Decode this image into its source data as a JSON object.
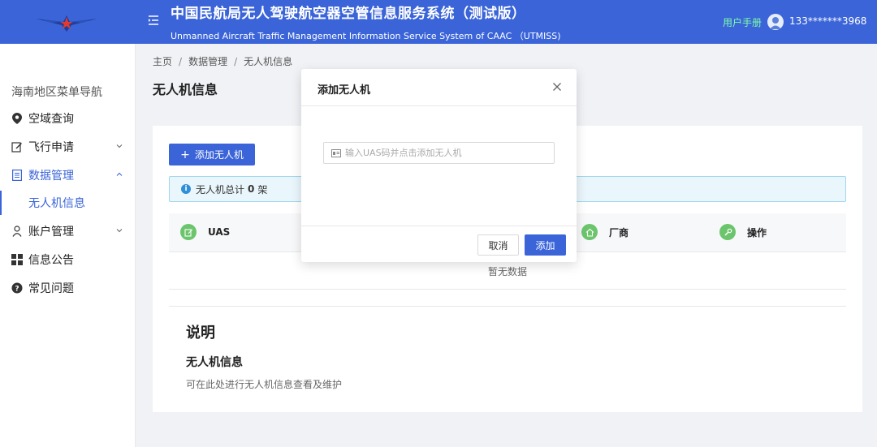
{
  "header": {
    "title_cn": "中国民航局无人驾驶航空器空管信息服务系统（测试版）",
    "title_en": "Unmanned Aircraft Traffic Management Information Service System of CAAC （UTMISS)",
    "manual_link": "用户手册",
    "phone": "133*******3968",
    "brand_color": "#3a64d8",
    "manual_color": "#7fffa8"
  },
  "sidebar": {
    "region_title": "海南地区菜单导航",
    "items": [
      {
        "label": "空域查询",
        "icon": "location-pin-icon"
      },
      {
        "label": "飞行申请",
        "icon": "edit-icon",
        "has_children": true
      },
      {
        "label": "数据管理",
        "icon": "list-icon",
        "has_children": true,
        "expanded": true
      },
      {
        "label": "账户管理",
        "icon": "user-icon",
        "has_children": true
      },
      {
        "label": "信息公告",
        "icon": "grid-icon"
      },
      {
        "label": "常见问题",
        "icon": "question-icon"
      }
    ],
    "sub_items": [
      {
        "label": "无人机信息",
        "active": true
      }
    ]
  },
  "breadcrumb": [
    "主页",
    "数据管理",
    "无人机信息"
  ],
  "page_title": "无人机信息",
  "main": {
    "add_button": "添加无人机",
    "info_prefix": "无人机总计",
    "info_count": "0",
    "info_suffix": "架",
    "table_columns": [
      {
        "label": "UAS",
        "icon": "edit-icon"
      },
      {
        "label": "厂商",
        "icon": "home-icon"
      },
      {
        "label": "操作",
        "icon": "wrench-icon"
      }
    ],
    "empty_text": "暂无数据",
    "section_title": "说明",
    "section_subtitle": "无人机信息",
    "section_desc": "可在此处进行无人机信息查看及维护"
  },
  "modal": {
    "title": "添加无人机",
    "input_placeholder": "输入UAS码并点击添加无人机",
    "input_value": "",
    "cancel_label": "取消",
    "confirm_label": "添加"
  }
}
